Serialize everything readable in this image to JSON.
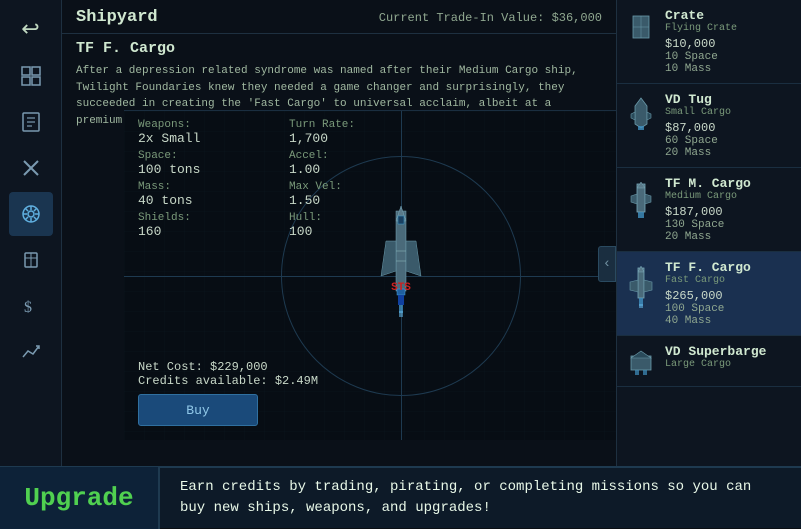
{
  "header": {
    "title": "Shipyard",
    "trade_in_label": "Current Trade-In Value: $36,000"
  },
  "ship": {
    "name": "TF F. Cargo",
    "description": "After a depression related syndrome was named after their Medium Cargo ship, Twilight Foundaries knew they needed a game changer and surprisingly, they succeeded in creating the 'Fast Cargo' to universal acclaim, albeit at a premium price.",
    "weapons_label": "Weapons:",
    "weapons_value": "2x Small",
    "turn_label": "Turn Rate:",
    "turn_value": "1,700",
    "space_label": "Space:",
    "space_value": "100 tons",
    "accel_label": "Accel:",
    "accel_value": "1.00",
    "mass_label": "Mass:",
    "mass_value": "40 tons",
    "maxvel_label": "Max Vel:",
    "maxvel_value": "1.50",
    "shields_label": "Shields:",
    "shields_value": "160",
    "hull_label": "Hull:",
    "hull_value": "100",
    "net_cost": "Net Cost: $229,000",
    "credits": "Credits available: $2.49M",
    "buy_label": "Buy",
    "sts_label": "STS"
  },
  "sidebar": {
    "icons": [
      {
        "id": "back",
        "symbol": "↩",
        "active": false
      },
      {
        "id": "map",
        "symbol": "⊞",
        "active": false
      },
      {
        "id": "missions",
        "symbol": "📋",
        "active": false
      },
      {
        "id": "tools",
        "symbol": "✦",
        "active": false
      },
      {
        "id": "helm",
        "symbol": "⚙",
        "active": true
      },
      {
        "id": "cargo",
        "symbol": "📦",
        "active": false
      },
      {
        "id": "finance",
        "symbol": "💲",
        "active": false
      },
      {
        "id": "stats",
        "symbol": "📈",
        "active": false
      }
    ]
  },
  "ship_list": [
    {
      "id": "crate",
      "name": "Crate",
      "type": "Flying Crate",
      "price": "$10,000",
      "stats": [
        "10 Space",
        "10 Mass"
      ],
      "active": false
    },
    {
      "id": "vd-tug",
      "name": "VD Tug",
      "type": "Small Cargo",
      "price": "$87,000",
      "stats": [
        "60 Space",
        "20 Mass"
      ],
      "active": false
    },
    {
      "id": "tf-m-cargo",
      "name": "TF M. Cargo",
      "type": "Medium Cargo",
      "price": "$187,000",
      "stats": [
        "130 Space",
        "20 Mass"
      ],
      "active": false
    },
    {
      "id": "tf-f-cargo",
      "name": "TF F. Cargo",
      "type": "Fast Cargo",
      "price": "$265,000",
      "stats": [
        "100 Space",
        "40 Mass"
      ],
      "active": true
    },
    {
      "id": "vd-superbarge",
      "name": "VD Superbarge",
      "type": "Large Cargo",
      "price": "",
      "stats": [],
      "active": false
    }
  ],
  "bottom_bar": {
    "upgrade_label": "Upgrade",
    "description": "Earn credits by trading, pirating, or completing missions so you can buy new ships, weapons, and upgrades!"
  },
  "collapse_button": "‹"
}
